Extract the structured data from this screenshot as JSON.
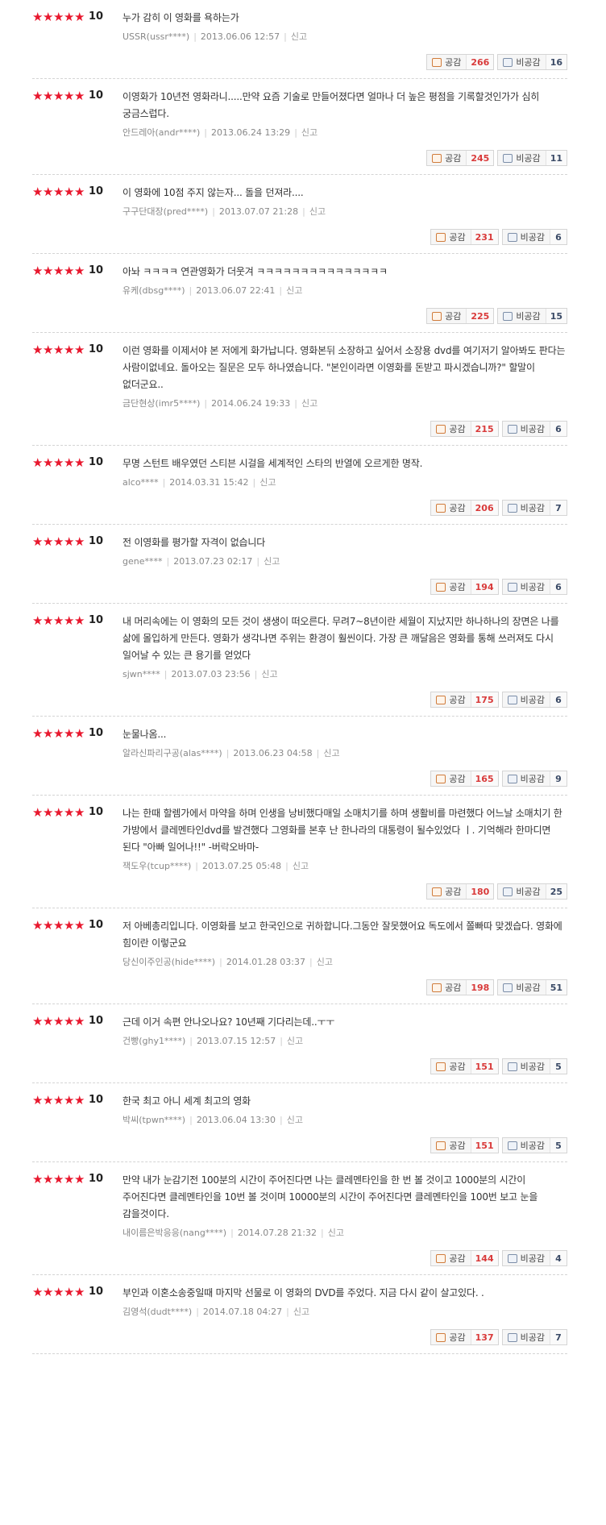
{
  "labels": {
    "agree": "공감",
    "disagree": "비공감",
    "report": "신고"
  },
  "colors": {
    "star": "#e8182e",
    "agree_count": "#d93a3a",
    "disagree_count": "#3a4a66"
  },
  "reviews": [
    {
      "score": "10",
      "text": "누가 감히 이 영화를 욕하는가",
      "user": "USSR(ussr****)",
      "date": "2013.06.06 12:57",
      "agree": "266",
      "disagree": "16"
    },
    {
      "score": "10",
      "text": "이영화가 10년전 영화라니.....만약 요즘 기술로 만들어졌다면 얼마나 더 높은 평점을 기록할것인가가 심히 궁금스럽다.",
      "user": "안드레아(andr****)",
      "date": "2013.06.24 13:29",
      "agree": "245",
      "disagree": "11"
    },
    {
      "score": "10",
      "text": "이 영화에 10점 주지 않는자... 돌을 던져라....",
      "user": "구구단대장(pred****)",
      "date": "2013.07.07 21:28",
      "agree": "231",
      "disagree": "6"
    },
    {
      "score": "10",
      "text": "아놔 ㅋㅋㅋㅋ 연관영화가 더웃겨 ㅋㅋㅋㅋㅋㅋㅋㅋㅋㅋㅋㅋㅋㅋㅋ",
      "user": "유케(dbsg****)",
      "date": "2013.06.07 22:41",
      "agree": "225",
      "disagree": "15"
    },
    {
      "score": "10",
      "text": "이런 영화를 이제서야 본 저에게 화가납니다. 영화본뒤 소장하고 싶어서 소장용 dvd를 여기저기 알아봐도 판다는 사람이없네요. 돌아오는 질문은 모두 하나였습니다. \"본인이라면 이영화를 돈받고 파시겠습니까?\" 할말이 없더군요..",
      "user": "금단현상(imr5****)",
      "date": "2014.06.24 19:33",
      "agree": "215",
      "disagree": "6"
    },
    {
      "score": "10",
      "text": "무명 스턴트 배우였던 스티븐 시걸을 세계적인 스타의 반열에 오르게한 명작.",
      "user": "alco****",
      "date": "2014.03.31 15:42",
      "agree": "206",
      "disagree": "7"
    },
    {
      "score": "10",
      "text": "전 이영화를 평가할 자격이 없습니다",
      "user": "gene****",
      "date": "2013.07.23 02:17",
      "agree": "194",
      "disagree": "6"
    },
    {
      "score": "10",
      "text": "내 머리속에는 이 영화의 모든 것이 생생이 떠오른다. 무려7~8년이란 세월이 지났지만 하나하나의 장면은 나를 삶에 몰입하게 만든다. 영화가 생각나면 주위는 환경이 훨씬이다. 가장 큰 깨달음은 영화를 통해 쓰러져도 다시 일어날 수 있는 큰 용기를 얻었다",
      "user": "sjwn****",
      "date": "2013.07.03 23:56",
      "agree": "175",
      "disagree": "6"
    },
    {
      "score": "10",
      "text": "눈물나옴...",
      "user": "알라신파리구공(alas****)",
      "date": "2013.06.23 04:58",
      "agree": "165",
      "disagree": "9"
    },
    {
      "score": "10",
      "text": "나는 한때 할렘가에서 마약을 하며 인생을 낭비했다매일 소매치기를 하며 생활비를 마련했다 어느날 소매치기 한 가방에서 클레멘타인dvd를 발견했다 그영화를 본후 난 한나라의 대통령이 될수있었다 ㅣ. 기억해라 한마디면 된다 \"아빠 일어나!!\" -버락오바마-",
      "user": "잭도우(tcup****)",
      "date": "2013.07.25 05:48",
      "agree": "180",
      "disagree": "25"
    },
    {
      "score": "10",
      "text": "저 아베총리입니다. 이영화를 보고 한국인으로 귀하합니다.그동안 잘못했어요 독도에서 쫄빠따 맞겠습다. 영화에 힘이란 이렇군요",
      "user": "당신이주인공(hide****)",
      "date": "2014.01.28 03:37",
      "agree": "198",
      "disagree": "51"
    },
    {
      "score": "10",
      "text": "근데 이거 속편 안나오나요? 10년째 기다리는데..ㅜㅜ",
      "user": "건빵(ghy1****)",
      "date": "2013.07.15 12:57",
      "agree": "151",
      "disagree": "5"
    },
    {
      "score": "10",
      "text": "한국 최고 아니 세계 최고의 영화",
      "user": "박씨(tpwn****)",
      "date": "2013.06.04 13:30",
      "agree": "151",
      "disagree": "5"
    },
    {
      "score": "10",
      "text": "만약 내가 눈감기전 100분의 시간이 주어진다면 나는 클레멘타인을 한 번 볼 것이고 1000분의 시간이 주어진다면 클레멘타인을 10번 볼 것이며 10000분의 시간이 주어진다면 클레멘타인을 100번 보고 눈을 감을것이다.",
      "user": "내이름은박응응(nang****)",
      "date": "2014.07.28 21:32",
      "agree": "144",
      "disagree": "4"
    },
    {
      "score": "10",
      "text": "부인과 이혼소송중일때 마지막 선물로 이 영화의 DVD를 주었다. 지금 다시 같이 살고있다. .",
      "user": "김영석(dudt****)",
      "date": "2014.07.18 04:27",
      "agree": "137",
      "disagree": "7"
    }
  ]
}
